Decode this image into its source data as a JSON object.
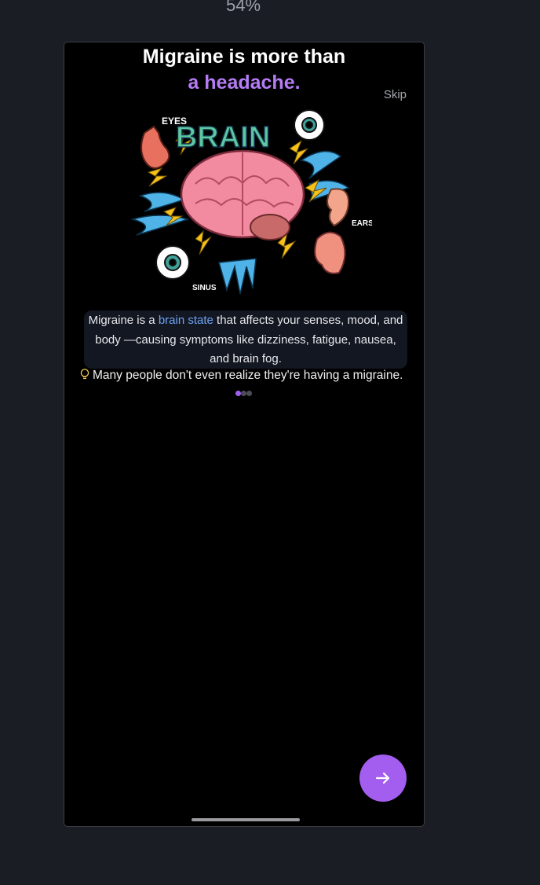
{
  "zoom_level": "54%",
  "onboarding": {
    "title_line1": "Migraine is more than",
    "title_line2": "a headache.",
    "skip_label": "Skip",
    "illustration_labels": {
      "brain": "BRAIN",
      "eyes": "EYES",
      "ears": "EARS",
      "sinus": "SINUS"
    },
    "description": {
      "pre": "Migraine is a ",
      "highlight": "brain state",
      "post": " that affects your senses, mood, and body —causing symptoms like dizziness, fatigue, nausea, and brain fog."
    },
    "tip_text": "Many people don't even realize they're having a migraine.",
    "pager": {
      "total": 3,
      "current": 1
    },
    "next_button_icon": "arrow-right-icon"
  },
  "colors": {
    "accent": "#a35ef0",
    "title_highlight": "#b57cf5",
    "link_highlight": "#6ea4f5",
    "bulb": "#f2c94c"
  }
}
